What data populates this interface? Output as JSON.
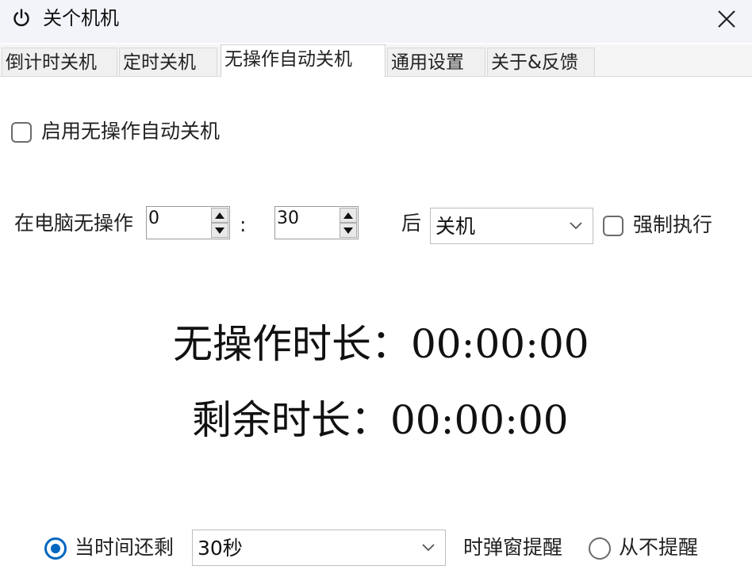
{
  "window": {
    "title": "关个机机",
    "close_icon": "close-icon",
    "app_icon": "power-icon"
  },
  "tabs": [
    {
      "label": "倒计时关机",
      "active": false
    },
    {
      "label": "定时关机",
      "active": false
    },
    {
      "label": "无操作自动关机",
      "active": true
    },
    {
      "label": "通用设置",
      "active": false
    },
    {
      "label": "关于&反馈",
      "active": false
    }
  ],
  "enable": {
    "label": "启用无操作自动关机",
    "checked": false
  },
  "idle_config": {
    "prefix_label": "在电脑无操作",
    "hours_value": "0",
    "separator": ":",
    "minutes_value": "30",
    "after_label": "后",
    "action_value": "关机",
    "force_label": "强制执行",
    "force_checked": false
  },
  "readouts": {
    "idle_label": "无操作时长：",
    "idle_value": "00:00:00",
    "remaining_label": "剩余时长：",
    "remaining_value": "00:00:00"
  },
  "reminder": {
    "option1_label": "当时间还剩",
    "option1_selected": true,
    "time_value": "30秒",
    "popup_label": "时弹窗提醒",
    "option2_label": "从不提醒",
    "option2_selected": false
  },
  "colors": {
    "accent": "#0067c0",
    "titlebar_bg": "#f2f4fa"
  }
}
